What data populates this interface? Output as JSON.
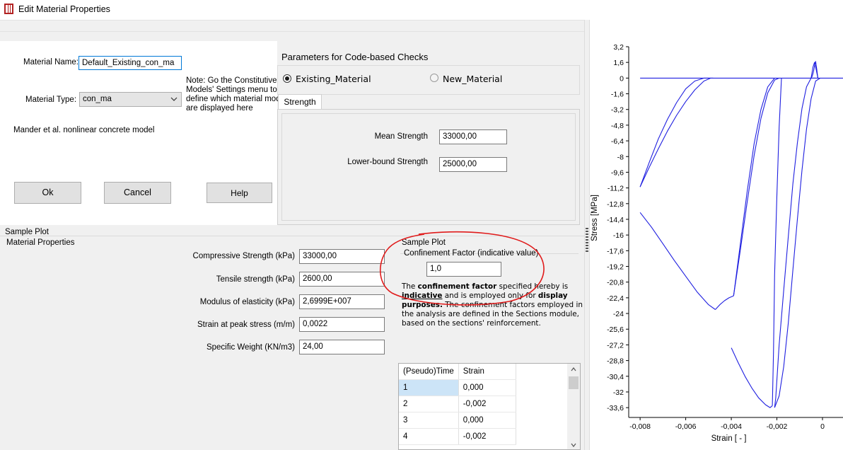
{
  "window": {
    "title": "Edit Material Properties"
  },
  "form": {
    "material_name_label": "Material Name:",
    "material_name_value": "Default_Existing_con_ma",
    "material_type_label": "Material Type:",
    "material_type_value": "con_ma",
    "note": "Note: Go the Constitutive Models' Settings menu to define which material models are displayed here",
    "note_lines": [
      "Note: Go the Constitutive",
      "Models' Settings menu to",
      "define which material mode",
      "are displayed here"
    ],
    "model_description": "Mander et al. nonlinear concrete model"
  },
  "buttons": {
    "ok": "Ok",
    "cancel": "Cancel",
    "help": "Help"
  },
  "code_checks": {
    "title": "Parameters for Code-based Checks",
    "radio_existing": "Existing_Material",
    "radio_new": "New_Material",
    "selected": "Existing_Material",
    "tab_strength": "Strength",
    "mean_strength_label": "Mean Strength",
    "mean_strength_value": "33000,00",
    "lower_bound_label": "Lower-bound Strength",
    "lower_bound_value": "25000,00"
  },
  "sample_plot_header": "Sample Plot",
  "material_properties": {
    "title": "Material Properties",
    "fields": [
      {
        "label": "Compressive Strength (kPa)",
        "value": "33000,00"
      },
      {
        "label": "Tensile strength (kPa)",
        "value": "2600,00"
      },
      {
        "label": "Modulus of elasticity (kPa)",
        "value": "2,6999E+007"
      },
      {
        "label": "Strain at peak stress (m/m)",
        "value": "0,0022"
      },
      {
        "label": "Specific Weight (KN/m3)",
        "value": "24,00"
      }
    ]
  },
  "sample_plot": {
    "title": "Sample Plot",
    "confinement_label": "Confinement Factor (indicative value)",
    "confinement_value": "1,0",
    "note_line1_pre": "The ",
    "note_line1_bold": "confinement factor",
    "note_line1_post": " specified hereby is",
    "note_line2_bold": "indicative",
    "note_line2_post": " and is employed only for ",
    "note_line2_bold2": "display",
    "note_line3_bold": "purposes.",
    "note_line3_post": " The confinement factors employed in",
    "note_line4": "the analysis are defined in the Sections module,",
    "note_line5": "based on the sections' reinforcement."
  },
  "table": {
    "headers": [
      "(Pseudo)Time",
      "Strain"
    ],
    "rows": [
      [
        "1",
        "0,000"
      ],
      [
        "2",
        "-0,002"
      ],
      [
        "3",
        "0,000"
      ],
      [
        "4",
        "-0,002"
      ]
    ],
    "selected_row": 0
  },
  "chart_data": {
    "type": "line",
    "xlabel": "Strain [ - ]",
    "ylabel": "Stress [MPa]",
    "xlim": [
      -0.0085,
      0.0009
    ],
    "ylim": [
      -34.6,
      3.2
    ],
    "x_ticks": [
      "-0,008",
      "-0,006",
      "-0,004",
      "-0,002",
      "0"
    ],
    "x_tick_values": [
      -0.008,
      -0.006,
      -0.004,
      -0.002,
      0
    ],
    "y_ticks": [
      "3,2",
      "1,6",
      "0",
      "-1,6",
      "-3,2",
      "-4,8",
      "-6,4",
      "-8",
      "-9,6",
      "-11,2",
      "-12,8",
      "-14,4",
      "-16",
      "-17,6",
      "-19,2",
      "-20,8",
      "-22,4",
      "-24",
      "-25,6",
      "-27,2",
      "-28,8",
      "-30,4",
      "-32",
      "-33,6"
    ],
    "y_tick_values": [
      3.2,
      1.6,
      0,
      -1.6,
      -3.2,
      -4.8,
      -6.4,
      -8,
      -9.6,
      -11.2,
      -12.8,
      -14.4,
      -16,
      -17.6,
      -19.2,
      -20.8,
      -22.4,
      -24,
      -25.6,
      -27.2,
      -28.8,
      -30.4,
      -32,
      -33.6
    ],
    "grid": false,
    "line_color": "#1f1fe0",
    "series": [
      {
        "x": [
          0.0009,
          0,
          -0.0004,
          -0.0005,
          -0.0008,
          -0.0012,
          -0.0016,
          -0.002,
          -0.0025,
          -0.003,
          -0.0035,
          -0.004,
          -0.0045,
          -0.005,
          -0.0055,
          -0.006,
          -0.0065,
          -0.007,
          -0.0075,
          -0.008
        ],
        "y": [
          0,
          0,
          0,
          0,
          0,
          0,
          0,
          0,
          0,
          0,
          0,
          0,
          0,
          0,
          0,
          0,
          0,
          0,
          0,
          0
        ]
      },
      {
        "x": [
          -0.0049,
          -0.0052,
          -0.0056,
          -0.006,
          -0.0064,
          -0.0068,
          -0.0072,
          -0.0076,
          -0.008
        ],
        "y": [
          0,
          -0.3,
          -1.2,
          -2.4,
          -3.8,
          -5.4,
          -7.2,
          -9.1,
          -11.1
        ]
      },
      {
        "x": [
          -0.008,
          -0.0076,
          -0.0072,
          -0.0068,
          -0.0064,
          -0.006,
          -0.0056,
          -0.0052,
          -0.0048
        ],
        "y": [
          -11.1,
          -8.6,
          -6.2,
          -4.2,
          -2.5,
          -1.1,
          -0.3,
          0,
          0
        ]
      },
      {
        "x": [
          -0.008,
          -0.0075,
          -0.007,
          -0.0065,
          -0.006,
          -0.0055,
          -0.005,
          -0.0047
        ],
        "y": [
          -13.7,
          -15.2,
          -16.9,
          -18.6,
          -20.2,
          -21.8,
          -23.1,
          -23.6
        ]
      },
      {
        "x": [
          -0.0047,
          -0.0045,
          -0.0043,
          -0.0041,
          -0.0039
        ],
        "y": [
          -23.6,
          -23.1,
          -22.7,
          -22.4,
          -22.2
        ]
      },
      {
        "x": [
          -0.0039,
          -0.0036,
          -0.0033,
          -0.003,
          -0.0027,
          -0.0024,
          -0.0021,
          -0.0019
        ],
        "y": [
          -22.2,
          -17.5,
          -12.6,
          -7.9,
          -4.1,
          -1.5,
          -0.2,
          0
        ]
      },
      {
        "x": [
          -0.0039,
          -0.0036,
          -0.0033,
          -0.003,
          -0.0027,
          -0.0024,
          -0.0021
        ],
        "y": [
          -22.2,
          -16.9,
          -11.5,
          -6.7,
          -3.2,
          -0.9,
          0
        ]
      },
      {
        "x": [
          -0.004,
          -0.0037,
          -0.0034,
          -0.0031,
          -0.0028,
          -0.0025,
          -0.0023,
          -0.0022
        ],
        "y": [
          -27.5,
          -29,
          -30.4,
          -31.6,
          -32.6,
          -33.3,
          -33.6,
          -33.4
        ]
      },
      {
        "x": [
          -0.0022,
          -0.00215,
          -0.0021,
          -0.002,
          -0.0019,
          -0.0018
        ],
        "y": [
          -33.4,
          -28,
          -20,
          -12,
          -5,
          0
        ]
      },
      {
        "x": [
          -0.0021,
          -0.00205,
          -0.002,
          -0.0019,
          -0.0017,
          -0.0015,
          -0.0013,
          -0.0011,
          -0.0009,
          -0.0007,
          -0.0005,
          -0.0003
        ],
        "y": [
          -33.6,
          -32.6,
          -30.8,
          -27.2,
          -21.6,
          -16.2,
          -10.8,
          -6.6,
          -3.1,
          -0.9,
          0,
          0
        ]
      },
      {
        "x": [
          -0.0021,
          -0.0019,
          -0.0017,
          -0.0015,
          -0.0013,
          -0.0011,
          -0.0009,
          -0.0007,
          -0.0005,
          -0.0003,
          -0.0001
        ],
        "y": [
          -33.6,
          -32.4,
          -29.4,
          -25,
          -19.6,
          -14.4,
          -9.4,
          -5.2,
          -2.1,
          -0.3,
          0
        ]
      },
      {
        "x": [
          -0.0005,
          -0.00045,
          -0.0004,
          -0.00035,
          -0.0003,
          -0.00025,
          -0.0002
        ],
        "y": [
          0,
          0.2,
          0.6,
          1.2,
          1.7,
          0.9,
          0
        ]
      },
      {
        "x": [
          -0.0005,
          -0.00042,
          -0.00035,
          -0.00028,
          -0.0002
        ],
        "y": [
          0,
          1.1,
          1.6,
          0.9,
          0
        ]
      }
    ]
  }
}
